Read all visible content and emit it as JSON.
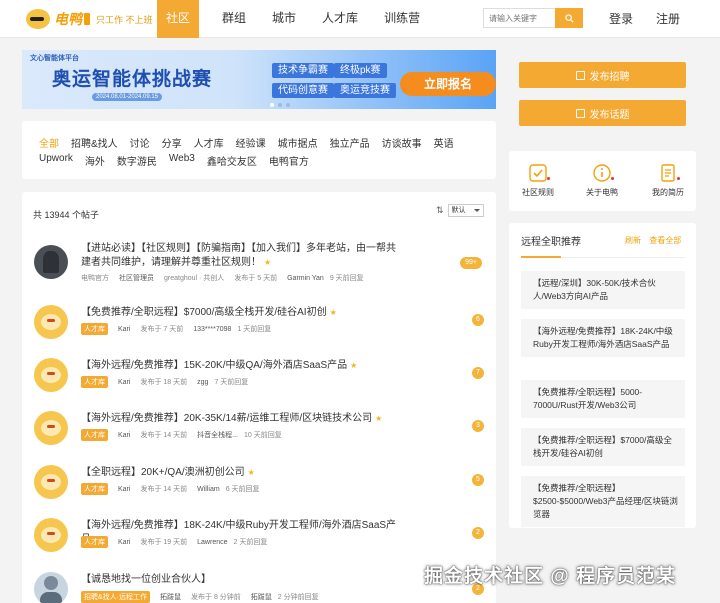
{
  "header": {
    "logo_text": "电鸭",
    "slogan": "只工作 不上班",
    "nav": [
      "社区",
      "群组",
      "城市",
      "人才库",
      "训练营"
    ],
    "search_placeholder": "请输入关键字",
    "login": "登录",
    "register": "注册"
  },
  "banner": {
    "sub": "文心智能体平台",
    "title": "奥运智能体挑战赛",
    "date": "2024.08.01-2024.09.15",
    "tags": [
      "技术争霸赛",
      "终极pk赛",
      "代码创意赛",
      "奥运竞技赛"
    ],
    "cta": "立即报名"
  },
  "categories": {
    "row1": [
      "全部",
      "招聘&找人",
      "讨论",
      "分享",
      "人才库",
      "经验课",
      "城市据点",
      "独立产品",
      "访谈故事",
      "英语"
    ],
    "row2": [
      "Upwork",
      "海外",
      "数字游民",
      "Web3",
      "鑫哈交友区",
      "电鸭官方"
    ]
  },
  "posts_header": {
    "count": "共 13944 个帖子",
    "sort_label": "默认"
  },
  "posts": [
    {
      "title": "【进站必读】【社区规则】【防骗指南】【加入我们】多年老站，由一帮共建者共同维护，请理解并尊重社区规则！",
      "badge": "电鸭官方",
      "author": "社区管理员",
      "posted": "greatghoul · 共创人",
      "time": "发布于 5 天前",
      "last_user": "Garmin Yan",
      "last_time": "9 天前回复",
      "count": "99+"
    },
    {
      "title": "【免费推荐/全职远程】$7000/高级全栈开发/硅谷AI初创",
      "badge": "人才库",
      "author": "Kari",
      "time": "发布于 7 天前",
      "last_user": "133****7098",
      "last_time": "1 天前回复",
      "count": "6"
    },
    {
      "title": "【海外远程/免费推荐】15K-20K/中级QA/海外酒店SaaS产品",
      "badge": "人才库",
      "author": "Kari",
      "time": "发布于 18 天前",
      "last_user": "zgg",
      "last_time": "7 天前回复",
      "count": "7"
    },
    {
      "title": "【海外远程/免费推荐】20K-35K/14薪/运维工程师/区块链技术公司",
      "badge": "人才库",
      "author": "Kari",
      "time": "发布于 14 天前",
      "last_user": "抖音全栈程...",
      "last_time": "10 天前回复",
      "count": "3"
    },
    {
      "title": "【全职远程】20K+/QA/澳洲初创公司",
      "badge": "人才库",
      "author": "Kari",
      "time": "发布于 14 天前",
      "last_user": "William",
      "last_time": "6 天前回复",
      "count": "5"
    },
    {
      "title": "【海外远程/免费推荐】18K-24K/中级Ruby开发工程师/海外酒店SaaS产品",
      "badge": "人才库",
      "author": "Kari",
      "time": "发布于 19 天前",
      "last_user": "Lawrence",
      "last_time": "2 天前回复",
      "count": "2"
    },
    {
      "title": "【诚恳地找一位创业合伙人】",
      "badge": "招聘&找人·远程工作",
      "author": "拓跋鼠",
      "time": "发布于 8 分钟前",
      "last_user": "拓跋鼠",
      "last_time": "2 分钟前回复",
      "count": "2"
    }
  ],
  "sidebar": {
    "publish_recruit": "发布招聘",
    "publish_topic": "发布话题",
    "icons": [
      {
        "label": "社区规则",
        "icon": "rules-icon"
      },
      {
        "label": "关于电鸭",
        "icon": "info-icon"
      },
      {
        "label": "我的简历",
        "icon": "resume-icon"
      }
    ],
    "rec_title": "远程全职推荐",
    "rec_links": [
      "刷新",
      "查看全部"
    ],
    "rec_items": [
      "【远程/深圳】30K-50K/技术合伙人/Web3方向AI产品",
      "【海外远程/免费推荐】18K-24K/中级Ruby开发工程师/海外酒店SaaS产品",
      "【免费推荐/全职远程】5000-7000U/Rust开发/Web3公司",
      "【免费推荐/全职远程】$7000/高级全栈开发/硅谷AI初创",
      "【免费推荐/全职远程】$2500-$5000/Web3产品经理/区块链浏览器"
    ]
  },
  "watermark": "掘金技术社区 @ 程序员范某",
  "colors": {
    "accent": "#f4a933",
    "brand": "#f4a00b"
  }
}
